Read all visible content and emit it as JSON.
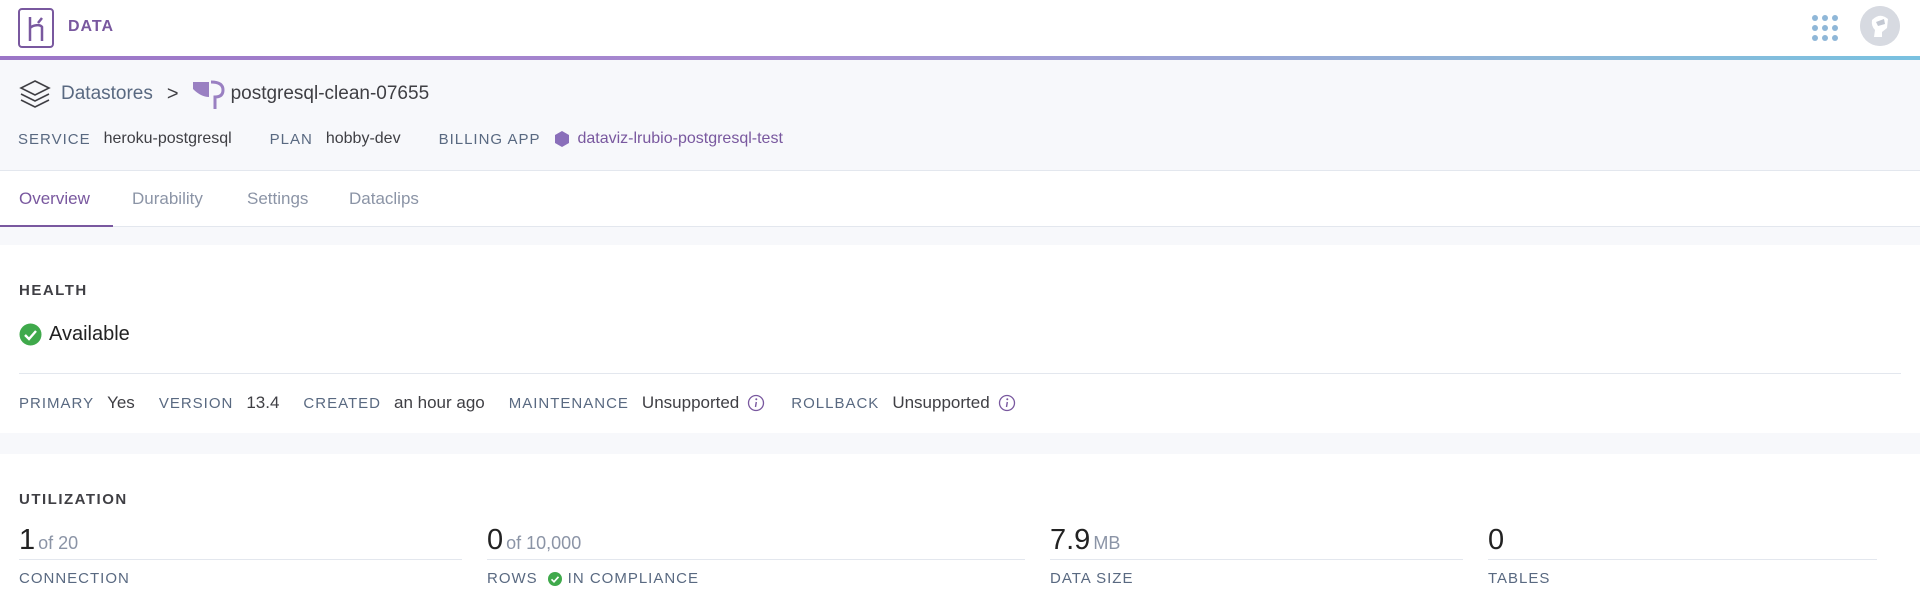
{
  "app": {
    "name": "DATA"
  },
  "breadcrumb": {
    "root": "Datastores",
    "current": "postgresql-clean-07655"
  },
  "meta": {
    "service_label": "SERVICE",
    "service": "heroku-postgresql",
    "plan_label": "PLAN",
    "plan": "hobby-dev",
    "billing_label": "BILLING APP",
    "billing_app": "dataviz-lrubio-postgresql-test"
  },
  "tabs": [
    {
      "label": "Overview",
      "active": true
    },
    {
      "label": "Durability"
    },
    {
      "label": "Settings"
    },
    {
      "label": "Dataclips"
    }
  ],
  "health": {
    "title": "HEALTH",
    "status": "Available",
    "primary_label": "PRIMARY",
    "primary": "Yes",
    "version_label": "VERSION",
    "version": "13.4",
    "created_label": "CREATED",
    "created": "an hour ago",
    "maintenance_label": "MAINTENANCE",
    "maintenance": "Unsupported",
    "rollback_label": "ROLLBACK",
    "rollback": "Unsupported"
  },
  "utilization": {
    "title": "UTILIZATION",
    "connections": {
      "value": "1",
      "unit": "of 20",
      "label": "CONNECTION"
    },
    "rows": {
      "value": "0",
      "unit": "of 10,000",
      "label": "ROWS",
      "compliance": "IN COMPLIANCE"
    },
    "data_size": {
      "value": "7.9",
      "unit": "MB",
      "label": "DATA SIZE"
    },
    "tables": {
      "value": "0",
      "unit": "",
      "label": "TABLES"
    }
  },
  "colors": {
    "accent": "#79589f",
    "success": "#3fa94b",
    "text": "#3f3f44",
    "muted": "#596981"
  }
}
